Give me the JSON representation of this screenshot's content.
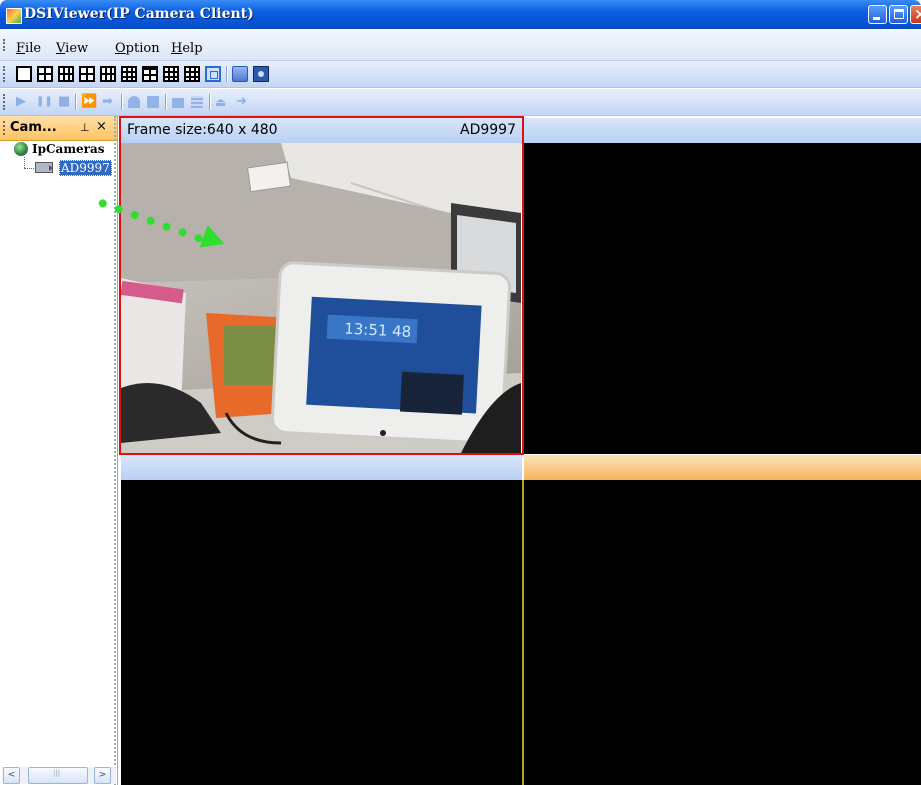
{
  "window": {
    "title": "DSIViewer(IP Camera Client)"
  },
  "menu": [
    {
      "label": "File",
      "key": "F",
      "rest": "ile"
    },
    {
      "label": "View",
      "key": "V",
      "rest": "iew"
    },
    {
      "label": "Option",
      "key": "O",
      "rest": "ption"
    },
    {
      "label": "Help",
      "key": "H",
      "rest": "elp"
    }
  ],
  "toolbar_layout": [
    "layout-1-icon",
    "layout-4-icon",
    "layout-6-icon",
    "layout-8-icon",
    "layout-9-icon",
    "layout-10-icon",
    "layout-13-icon",
    "layout-16-icon",
    "layout-25-icon",
    "fullscreen-icon",
    "record-icon",
    "snapshot-icon"
  ],
  "toolbar_playback": {
    "glyphs": [
      "▶",
      "❚❚",
      "■",
      "⏩",
      "➡",
      "➜"
    ],
    "icons": [
      "play-icon",
      "pause-icon",
      "stop-icon",
      "fast-forward-icon",
      "step-icon",
      "record-all-icon",
      "stop-record-icon",
      "folder-icon",
      "grid-icon",
      "eject-icon",
      "arrow-right-icon"
    ]
  },
  "dock": {
    "title": "Cam...",
    "pin_glyph": "⊥",
    "close_glyph": "×",
    "tree": {
      "root": "IpCameras",
      "cameras": [
        "AD9997"
      ]
    }
  },
  "panes": [
    {
      "frame_size_label": "Frame size:640 x 480",
      "camera_name": "AD9997",
      "state": "selected"
    },
    {
      "frame_size_label": "",
      "camera_name": "",
      "state": "empty"
    },
    {
      "frame_size_label": "",
      "camera_name": "",
      "state": "empty"
    },
    {
      "frame_size_label": "",
      "camera_name": "",
      "state": "active-empty"
    }
  ],
  "scene": {
    "clock_text": "13:51 48"
  },
  "scrollbar": {
    "left_glyph": "<",
    "right_glyph": ">"
  },
  "colors": {
    "accent_green_arrow": "#2ee02e",
    "selected_frame": "#e01010",
    "active_header": "#f6b259"
  }
}
